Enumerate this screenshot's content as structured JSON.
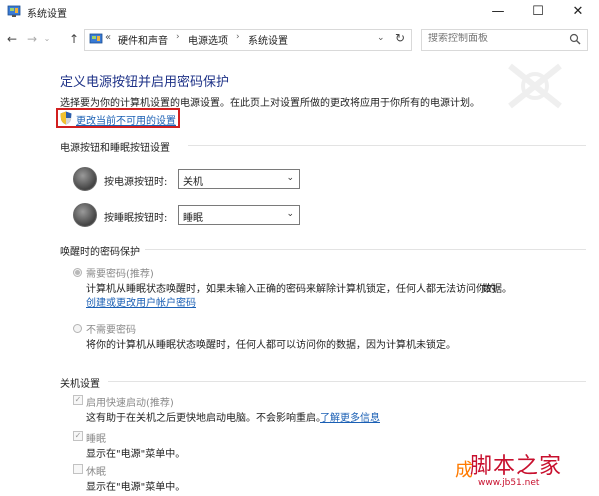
{
  "window": {
    "title": "系统设置",
    "min_glyph": "—",
    "max_glyph": "☐",
    "close_glyph": "✕"
  },
  "nav": {
    "back_glyph": "←",
    "forward_glyph": "→",
    "recent_glyph": "⌄",
    "up_glyph": "↑"
  },
  "address": {
    "overflow": "«",
    "crumbs": [
      "硬件和声音",
      "电源选项",
      "系统设置"
    ],
    "separator": "›",
    "dropdown_glyph": "⌄",
    "refresh_glyph": "↻"
  },
  "search": {
    "placeholder": "搜索控制面板"
  },
  "page": {
    "heading": "定义电源按钮并启用密码保护",
    "description": "选择要为你的计算机设置的电源设置。在此页上对设置所做的更改将应用于你所有的电源计划。",
    "change_link": "更改当前不可用的设置"
  },
  "power_buttons": {
    "section_title": "电源按钮和睡眠按钮设置",
    "power_label": "按电源按钮时:",
    "power_value": "关机",
    "sleep_label": "按睡眠按钮时:",
    "sleep_value": "睡眠"
  },
  "wake_password": {
    "section_title": "唤醒时的密码保护",
    "require_label": "需要密码(推荐)",
    "require_desc": "计算机从睡眠状态唤醒时，如果未输入正确的密码来解除计算机锁定，任何人都无法访问你的",
    "require_desc2": "数据。",
    "require_link": "创建或更改用户帐户密码",
    "norequire_label": "不需要密码",
    "norequire_desc": "将你的计算机从睡眠状态唤醒时，任何人都可以访问你的数据，因为计算机未锁定。"
  },
  "shutdown": {
    "section_title": "关机设置",
    "fast_label": "启用快速启动(推荐)",
    "fast_desc": "这有助于在关机之后更快地启动电脑。不会影响重启。",
    "fast_link": "了解更多信息",
    "sleep_label": "睡眠",
    "sleep_desc": "显示在\"电源\"菜单中。",
    "hibernate_label": "休眠",
    "hibernate_desc": "显示在\"电源\"菜单中。",
    "checked_glyph": "✓"
  },
  "watermark": {
    "brand": "脚本之家",
    "brand_first": "成",
    "url": "www.jb51.net"
  },
  "colors": {
    "heading": "#1e3287",
    "link": "#1a5fb4",
    "highlight_border": "#d11f1f",
    "watermark": "#c8102e"
  }
}
